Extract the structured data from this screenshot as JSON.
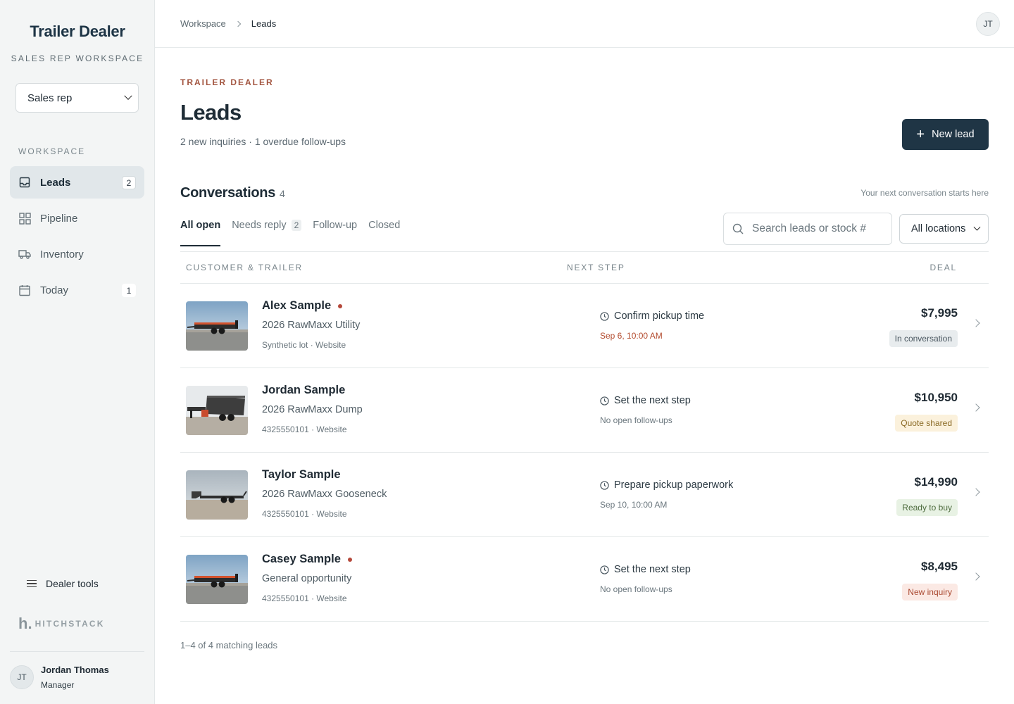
{
  "sidebar": {
    "brand": "Trailer Dealer",
    "brand_sub": "SALES REP WORKSPACE",
    "role_select": "Sales rep",
    "section_label": "WORKSPACE",
    "items": [
      {
        "label": "Leads",
        "count": "2",
        "icon": "inbox-icon",
        "active": true
      },
      {
        "label": "Pipeline",
        "count": "",
        "icon": "grid-icon",
        "active": false
      },
      {
        "label": "Inventory",
        "count": "",
        "icon": "truck-icon",
        "active": false
      },
      {
        "label": "Today",
        "count": "1",
        "icon": "calendar-icon",
        "active": false
      }
    ],
    "dealer_tools": "Dealer tools",
    "logo_text": "HITCHSTACK",
    "user": {
      "initials": "JT",
      "name": "Jordan Thomas",
      "role": "Manager"
    }
  },
  "topbar": {
    "breadcrumb": [
      "Workspace",
      "Leads"
    ],
    "avatar_initials": "JT"
  },
  "header": {
    "eyebrow": "TRAILER DEALER",
    "title": "Leads",
    "subtitle": "2 new inquiries · 1 overdue follow-ups",
    "new_lead_label": "New lead"
  },
  "conversations": {
    "title": "Conversations",
    "count": "4",
    "hint": "Your next conversation starts here",
    "tabs": [
      {
        "label": "All open",
        "badge": "",
        "active": true
      },
      {
        "label": "Needs reply",
        "badge": "2",
        "active": false
      },
      {
        "label": "Follow-up",
        "badge": "",
        "active": false
      },
      {
        "label": "Closed",
        "badge": "",
        "active": false
      }
    ],
    "search_placeholder": "Search leads or stock #",
    "location_select": "All locations",
    "columns": [
      "CUSTOMER & TRAILER",
      "NEXT STEP",
      "DEAL"
    ],
    "rows": [
      {
        "name": "Alex Sample",
        "unread": true,
        "trailer": "2026 RawMaxx Utility",
        "meta": "Synthetic lot · Website",
        "step": "Confirm pickup time",
        "step_date": "Sep 6, 10:00 AM",
        "overdue": true,
        "amount": "$7,995",
        "status": "In conversation",
        "status_bg": "#e8ecee",
        "status_fg": "#4a5760",
        "trailer_kind": "utility"
      },
      {
        "name": "Jordan Sample",
        "unread": false,
        "trailer": "2026 RawMaxx Dump",
        "meta": "4325550101 · Website",
        "step": "Set the next step",
        "step_date": "No open follow-ups",
        "overdue": false,
        "amount": "$10,950",
        "status": "Quote shared",
        "status_bg": "#fbf1dc",
        "status_fg": "#8a6a25",
        "trailer_kind": "dump"
      },
      {
        "name": "Taylor Sample",
        "unread": false,
        "trailer": "2026 RawMaxx Gooseneck",
        "meta": "4325550101 · Website",
        "step": "Prepare pickup paperwork",
        "step_date": "Sep 10, 10:00 AM",
        "overdue": false,
        "amount": "$14,990",
        "status": "Ready to buy",
        "status_bg": "#e8f2e4",
        "status_fg": "#4d6b3d",
        "trailer_kind": "gooseneck"
      },
      {
        "name": "Casey Sample",
        "unread": true,
        "trailer": "General opportunity",
        "meta": "4325550101 · Website",
        "step": "Set the next step",
        "step_date": "No open follow-ups",
        "overdue": false,
        "amount": "$8,495",
        "status": "New inquiry",
        "status_bg": "#fbe9e4",
        "status_fg": "#a9472f",
        "trailer_kind": "utility"
      }
    ],
    "footer": "1–4 of 4 matching leads"
  }
}
